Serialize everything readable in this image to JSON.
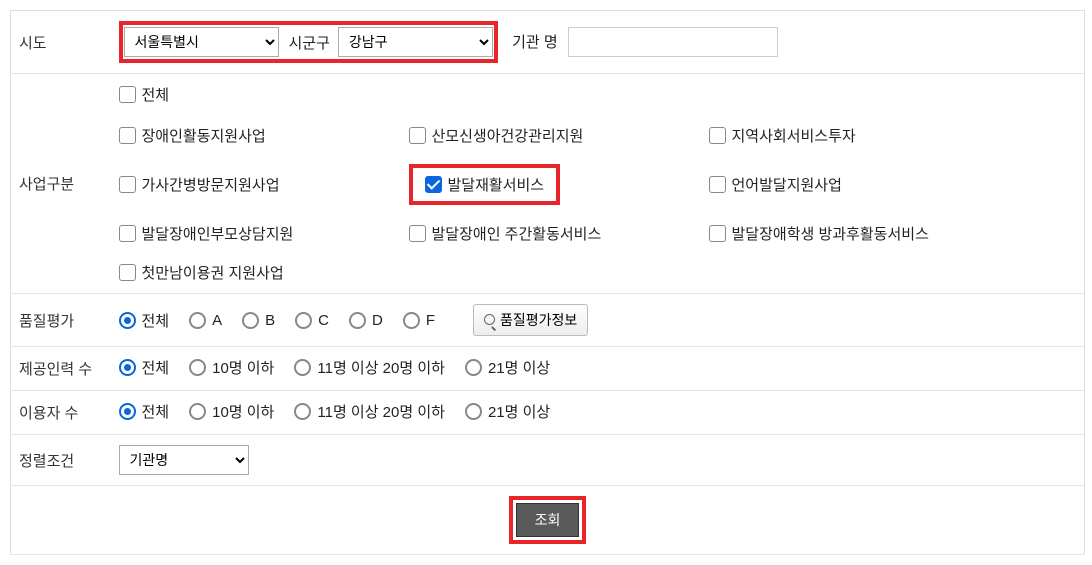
{
  "row_sido": {
    "label": "시도",
    "sido_value": "서울특별시",
    "sigungu_label": "시군구",
    "sigungu_value": "강남구",
    "inst_label": "기관 명",
    "inst_value": ""
  },
  "row_business": {
    "label": "사업구분",
    "items": [
      {
        "label": "전체",
        "checked": false
      },
      {
        "label": "장애인활동지원사업",
        "checked": false
      },
      {
        "label": "산모신생아건강관리지원",
        "checked": false
      },
      {
        "label": "지역사회서비스투자",
        "checked": false
      },
      {
        "label": "가사간병방문지원사업",
        "checked": false
      },
      {
        "label": "발달재활서비스",
        "checked": true
      },
      {
        "label": "언어발달지원사업",
        "checked": false
      },
      {
        "label": "발달장애인부모상담지원",
        "checked": false
      },
      {
        "label": "발달장애인 주간활동서비스",
        "checked": false
      },
      {
        "label": "발달장애학생 방과후활동서비스",
        "checked": false
      },
      {
        "label": "첫만남이용권 지원사업",
        "checked": false
      }
    ]
  },
  "row_quality": {
    "label": "품질평가",
    "options": [
      "전체",
      "A",
      "B",
      "C",
      "D",
      "F"
    ],
    "selected": "전체",
    "info_btn": "품질평가정보"
  },
  "row_staff": {
    "label": "제공인력 수",
    "options": [
      "전체",
      "10명 이하",
      "11명 이상 20명 이하",
      "21명 이상"
    ],
    "selected": "전체"
  },
  "row_users": {
    "label": "이용자 수",
    "options": [
      "전체",
      "10명 이하",
      "11명 이상 20명 이하",
      "21명 이상"
    ],
    "selected": "전체"
  },
  "row_sort": {
    "label": "정렬조건",
    "value": "기관명"
  },
  "submit_label": "조회"
}
